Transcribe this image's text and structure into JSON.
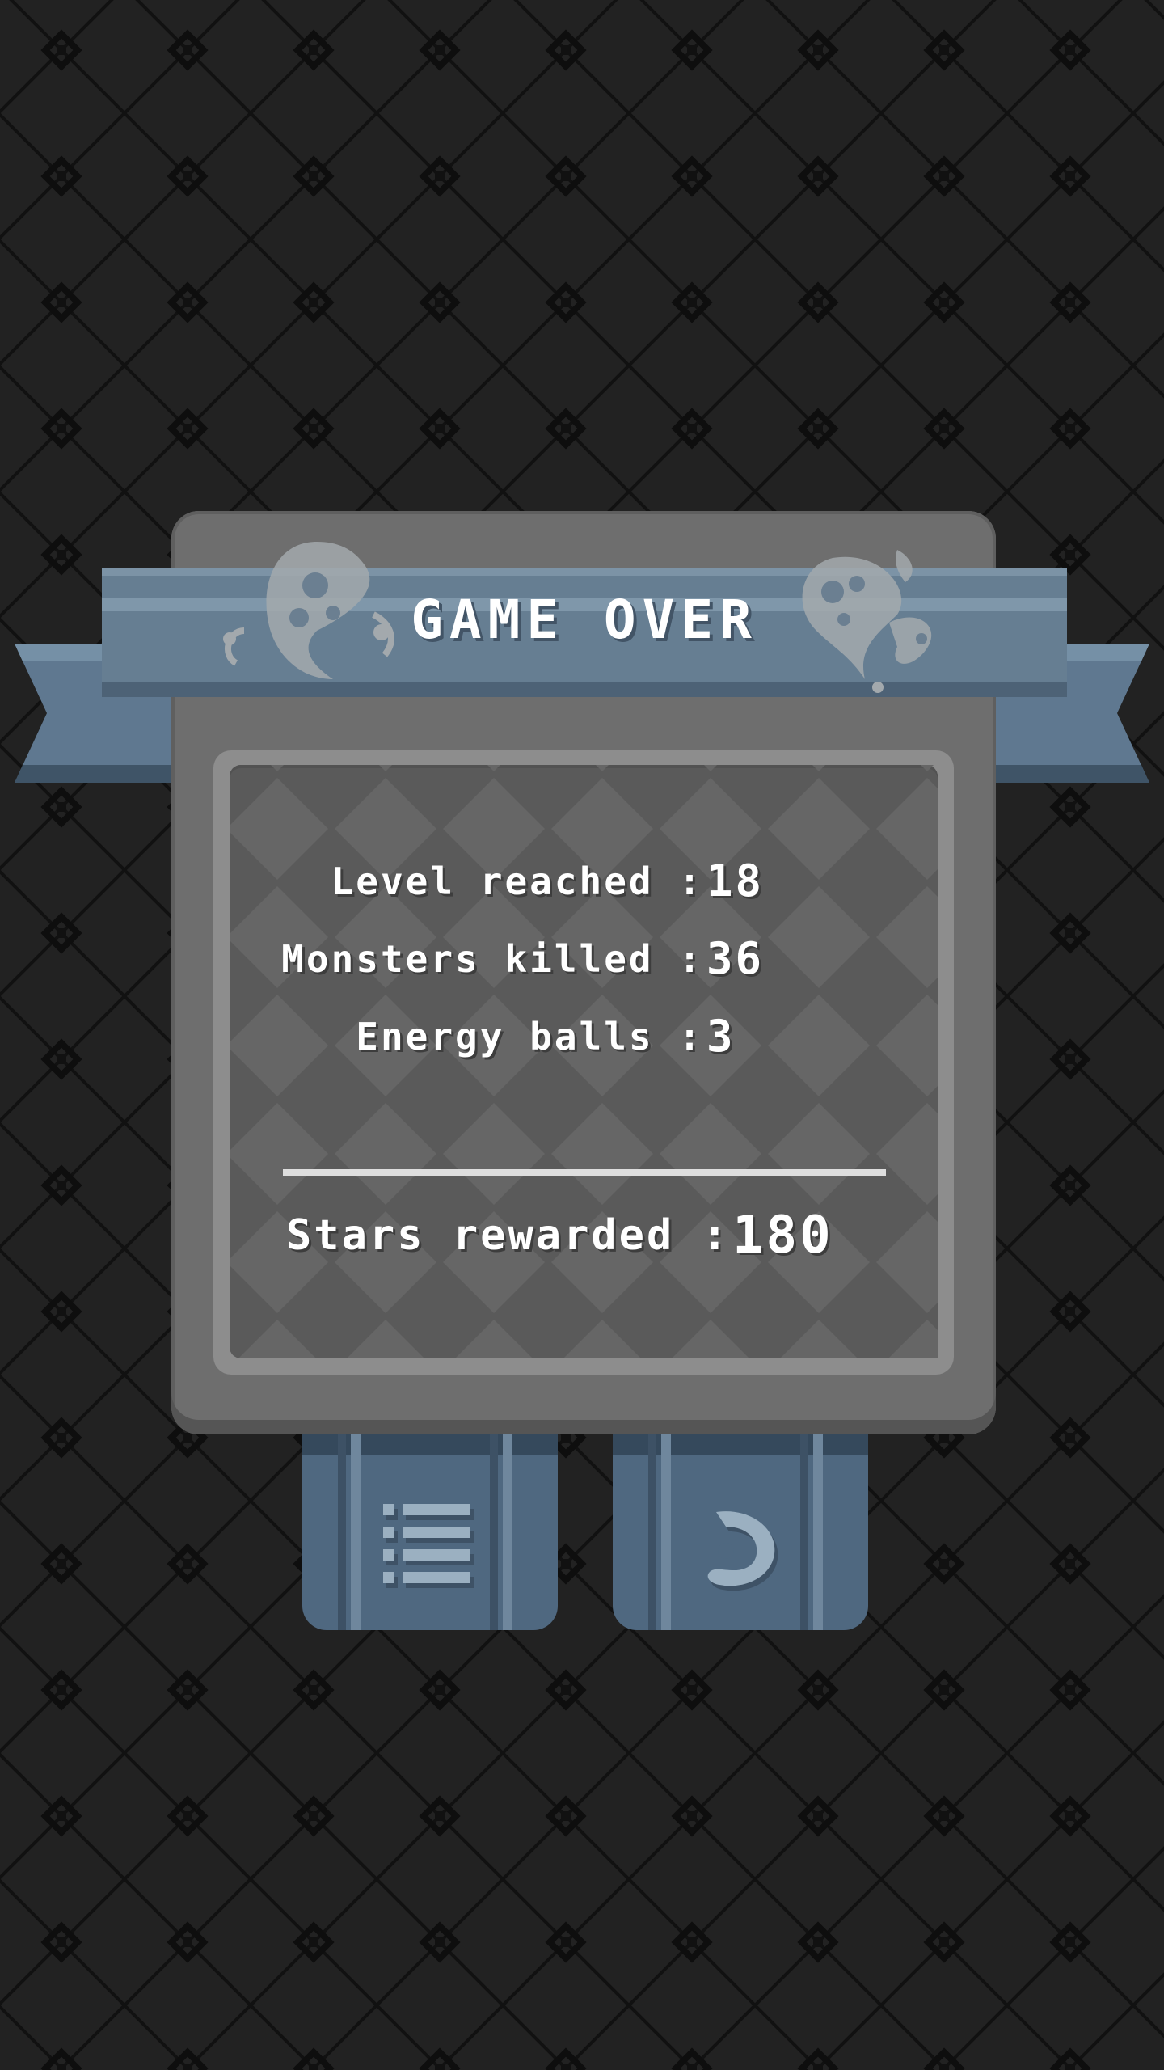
{
  "screen": {
    "title": "GAME OVER"
  },
  "stats": [
    {
      "label": "Level reached :",
      "value": "18"
    },
    {
      "label": "Monsters killed :",
      "value": "36"
    },
    {
      "label": "Energy balls :",
      "value": "3"
    }
  ],
  "reward": {
    "label": "Stars rewarded :",
    "value": "180"
  },
  "buttons": {
    "menu": {
      "icon": "list-icon"
    },
    "next": {
      "icon": "swirl-arrow-icon"
    }
  },
  "colors": {
    "background": "#222222",
    "panel": "#6e6e6e",
    "banner": "#667e92",
    "button": "#4f6880",
    "text": "#ffffff"
  }
}
